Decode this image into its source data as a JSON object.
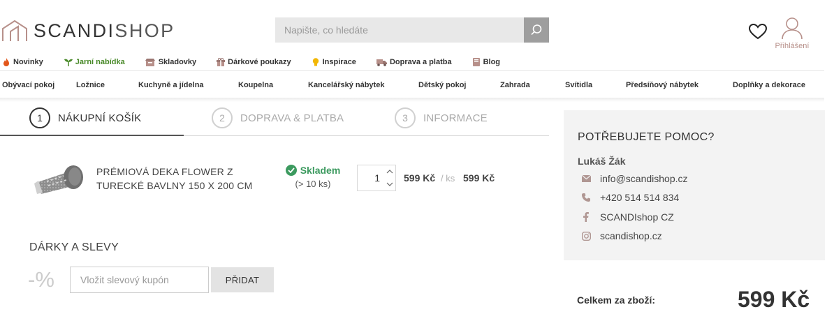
{
  "header": {
    "logo": {
      "brand_bold": "SCANDI",
      "brand_light": "SHOP"
    },
    "search": {
      "placeholder": "Napište, co hledáte"
    },
    "user_label": "Přihlášení"
  },
  "subnav": [
    {
      "label": "Novinky",
      "icon": "flame-icon",
      "color": "#e2561a"
    },
    {
      "label": "Jarní nabídka",
      "icon": "sprout-icon",
      "color": "#4a8a2a"
    },
    {
      "label": "Skladovky",
      "icon": "box-icon",
      "color": "#b7908a"
    },
    {
      "label": "Dárkové poukazy",
      "icon": "gift-icon",
      "color": "#b7908a"
    },
    {
      "label": "Inspirace",
      "icon": "lightbulb-icon",
      "color": "#f2b705"
    },
    {
      "label": "Doprava a platba",
      "icon": "truck-icon",
      "color": "#b7908a"
    },
    {
      "label": "Blog",
      "icon": "book-icon",
      "color": "#b7908a"
    }
  ],
  "categories": [
    "Obývací pokoj",
    "Ložnice",
    "Kuchyně a jídelna",
    "Koupelna",
    "Kancelářský nábytek",
    "Dětský pokoj",
    "Zahrada",
    "Svítidla",
    "Předsíňový nábytek",
    "Doplňky a dekorace"
  ],
  "steps": [
    {
      "num": "1",
      "label": "NÁKUPNÍ KOŠÍK",
      "active": true
    },
    {
      "num": "2",
      "label": "DOPRAVA & PLATBA",
      "active": false
    },
    {
      "num": "3",
      "label": "INFORMACE",
      "active": false
    }
  ],
  "cart": {
    "item": {
      "name": "PRÉMIOVÁ DEKA FLOWER Z TURECKÉ BAVLNY 150 X 200 CM",
      "stock": "Skladem",
      "stock_detail": "(> 10 ks)",
      "quantity": "1",
      "unit_price": "599 Kč",
      "per_unit": "/ ks",
      "total": "599 Kč"
    }
  },
  "gifts": {
    "title": "DÁRKY A SLEVY",
    "percent_symbol": "-%",
    "coupon_placeholder": "Vložit slevový kupón",
    "add_label": "PŘIDAT"
  },
  "help": {
    "title": "POTŘEBUJETE POMOC?",
    "name": "Lukáš Žák",
    "email": "info@scandishop.cz",
    "phone": "+420 514 514 834",
    "facebook": "SCANDIshop CZ",
    "instagram": "scandishop.cz"
  },
  "summary": {
    "label": "Celkem za zboží:",
    "value": "599 Kč"
  },
  "colors": {
    "accent": "#b7908a",
    "stock_green": "#3c9a5f",
    "help_bg": "#f3f3f3"
  }
}
